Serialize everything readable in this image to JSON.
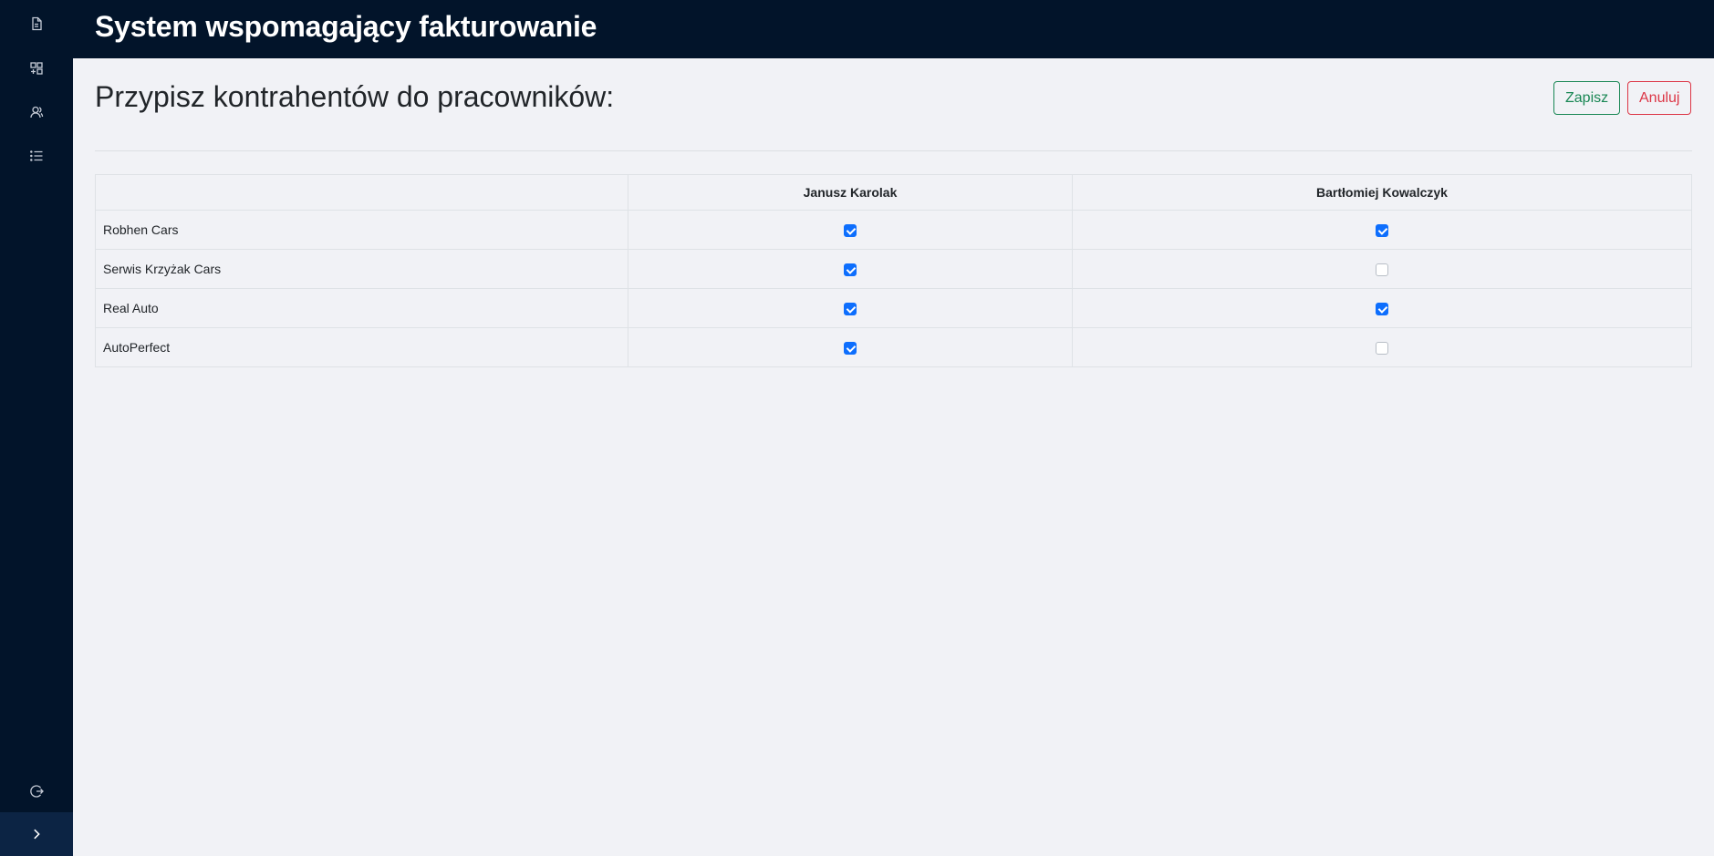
{
  "app": {
    "title": "System wspomagający fakturowanie"
  },
  "sidebar": {
    "items": [
      {
        "icon": "document-icon"
      },
      {
        "icon": "dashboard-add-icon"
      },
      {
        "icon": "users-icon"
      },
      {
        "icon": "list-icon"
      }
    ],
    "logout_icon": "logout-icon",
    "expand_icon": "chevron-right-icon"
  },
  "page": {
    "title": "Przypisz kontrahentów do pracowników:"
  },
  "actions": {
    "save_label": "Zapisz",
    "cancel_label": "Anuluj"
  },
  "table": {
    "columns": [
      "",
      "Janusz Karolak",
      "Bartłomiej Kowalczyk"
    ],
    "rows": [
      {
        "name": "Robhen Cars",
        "assigned": [
          true,
          true
        ]
      },
      {
        "name": "Serwis Krzyżak Cars",
        "assigned": [
          true,
          false
        ]
      },
      {
        "name": "Real Auto",
        "assigned": [
          true,
          true
        ]
      },
      {
        "name": "AutoPerfect",
        "assigned": [
          true,
          false
        ]
      }
    ]
  },
  "colors": {
    "sidebar_bg": "#02142a",
    "page_bg": "#f1f2f6",
    "save": "#198754",
    "cancel": "#dc3545",
    "checkbox": "#0d6efd"
  }
}
